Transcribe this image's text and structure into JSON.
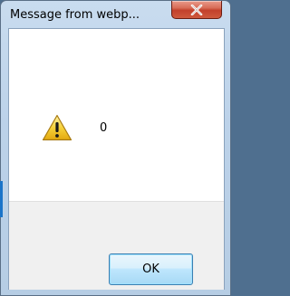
{
  "dialog": {
    "title": "Message from webp...",
    "message": "0",
    "ok_label": "OK"
  },
  "icons": {
    "close": "close-icon",
    "warning": "warning-icon"
  },
  "colors": {
    "close_button": "#c2402b",
    "frame": "#bcd2e9",
    "ok_button": "#bee6fd"
  }
}
